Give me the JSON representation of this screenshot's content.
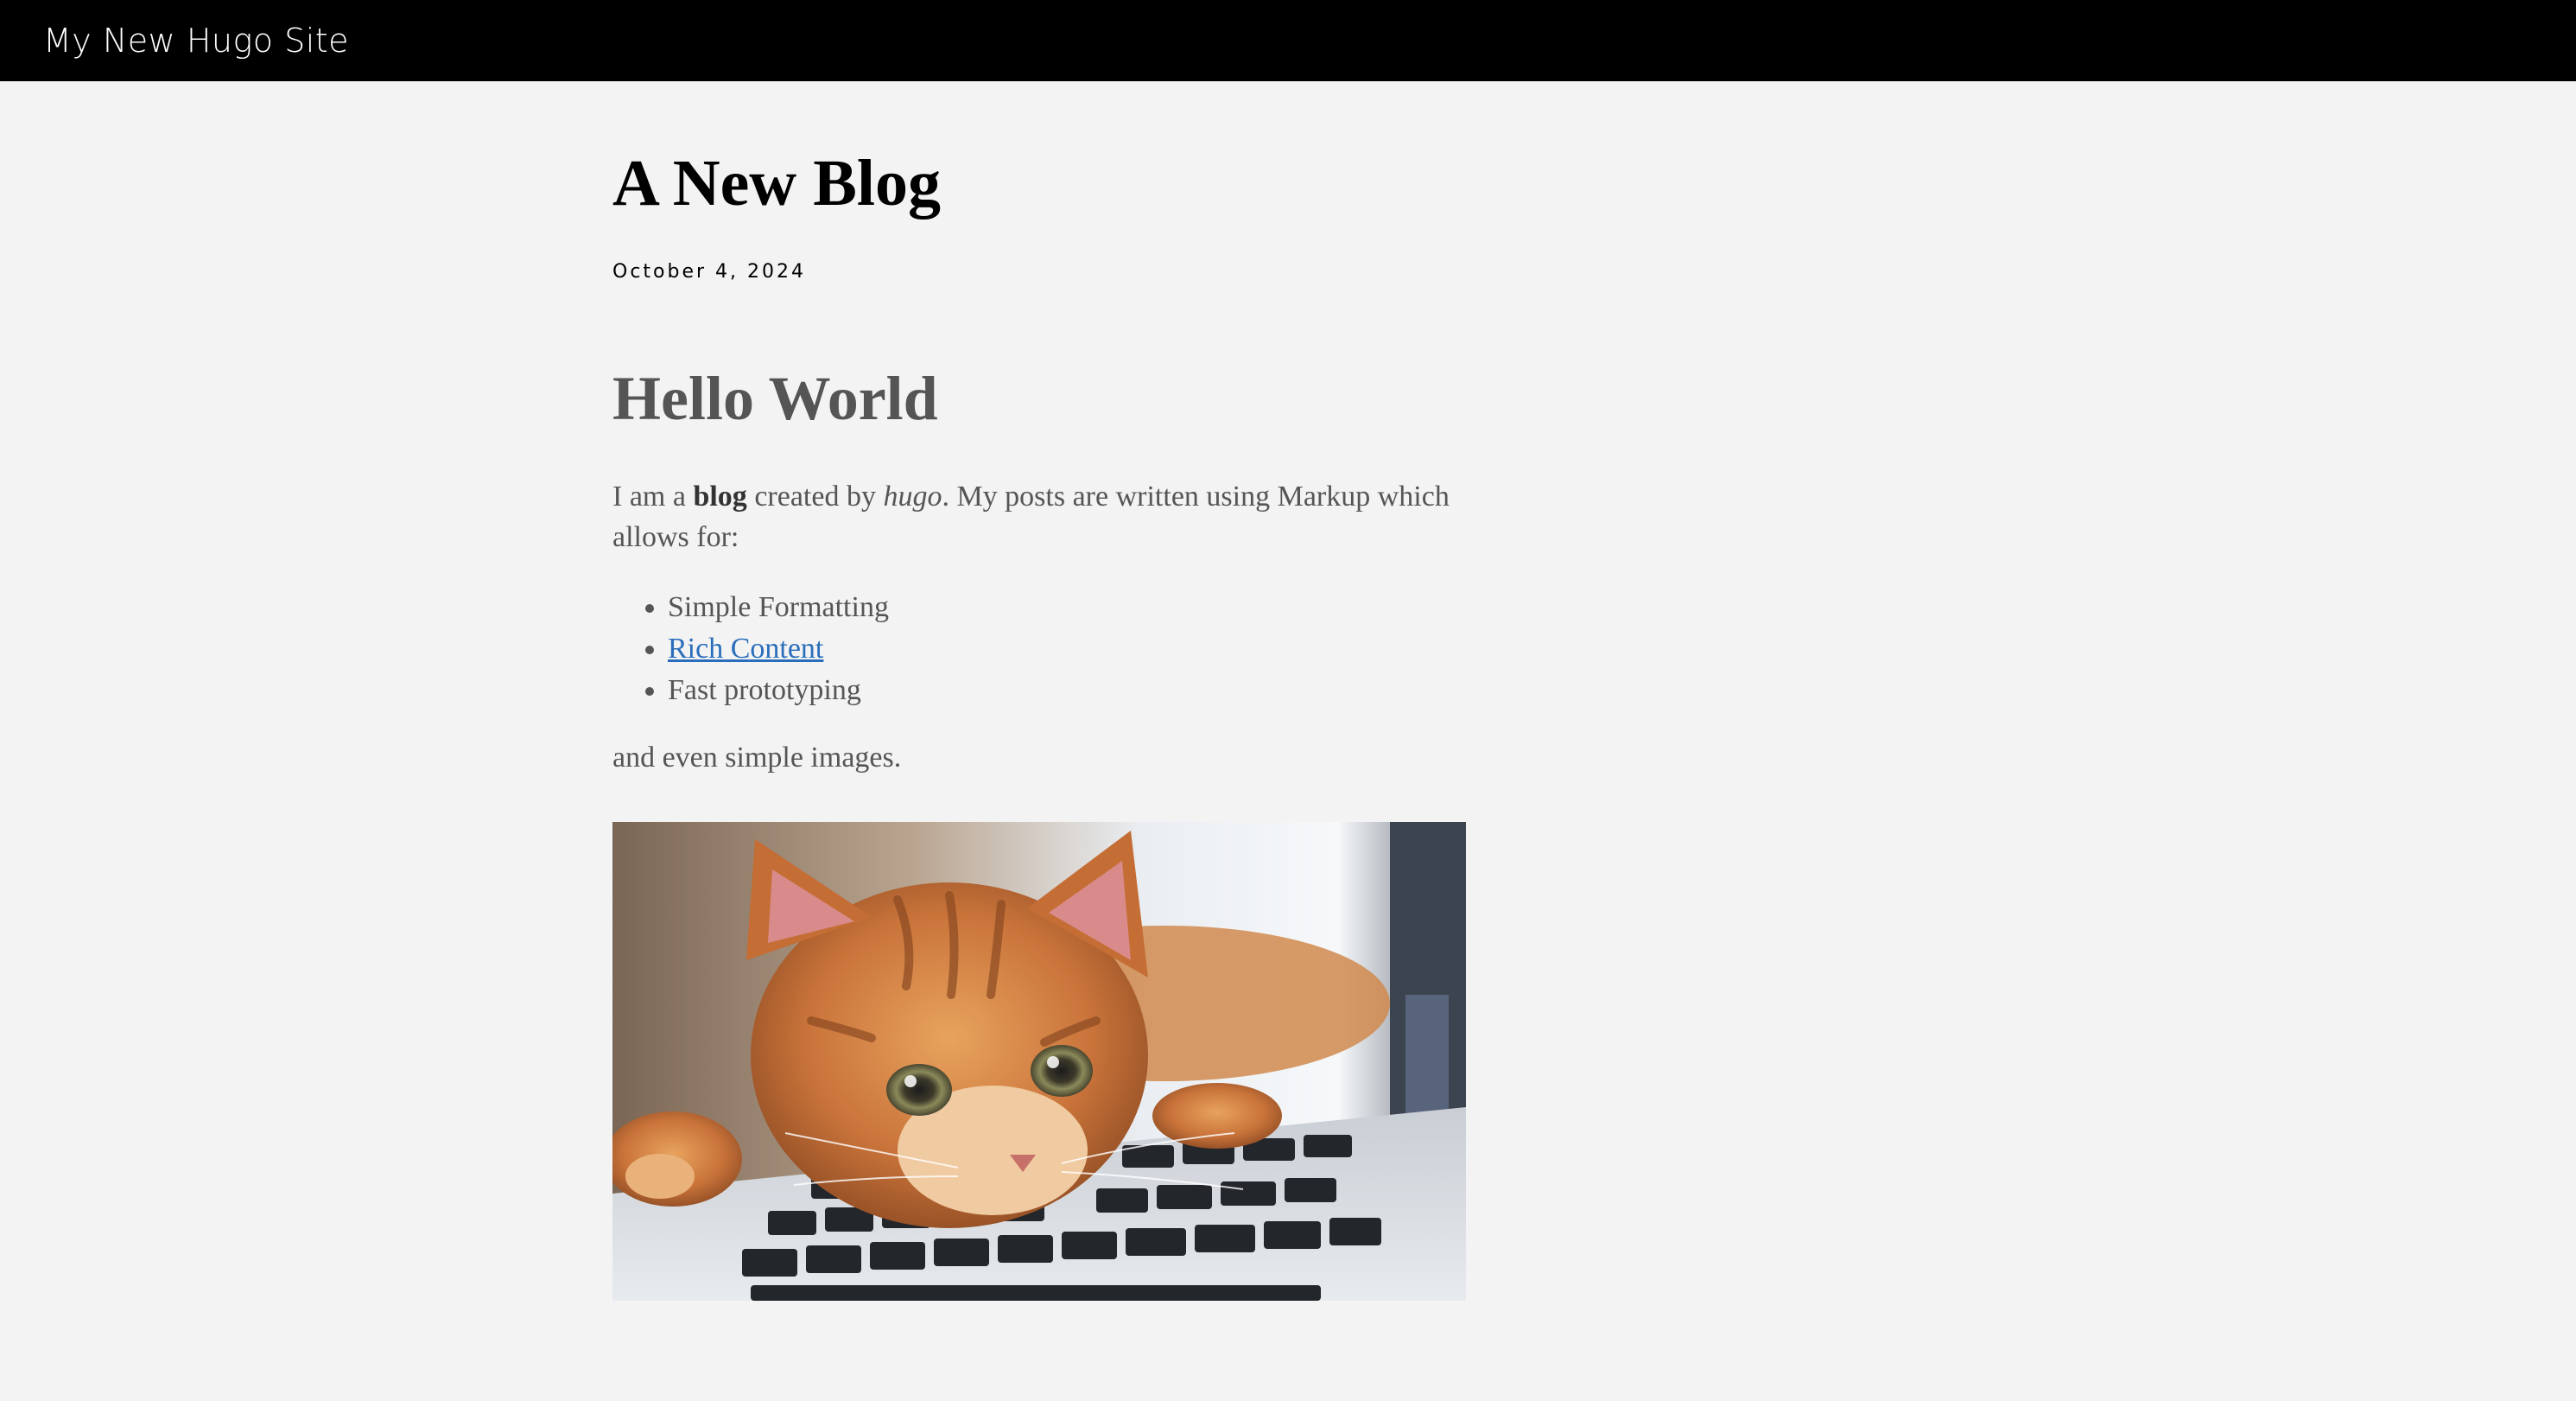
{
  "header": {
    "site_title": "My New Hugo Site"
  },
  "post": {
    "title": "A New Blog",
    "date": "October 4, 2024",
    "heading": "Hello World",
    "intro": {
      "part1": "I am a ",
      "bold": "blog",
      "part2": " created by ",
      "italic": "hugo",
      "part3": ". My posts are written using Markup which allows for:"
    },
    "list": [
      {
        "text": "Simple Formatting"
      },
      {
        "text": "Rich Content",
        "is_link": true
      },
      {
        "text": "Fast prototyping"
      }
    ],
    "outro": "and even simple images.",
    "image": {
      "subject": "orange tabby kitten lying on a laptop keyboard"
    }
  },
  "colors": {
    "header_bg": "#000000",
    "page_bg": "#f3f3f3",
    "body_text": "#555555",
    "link": "#2a6ebb"
  }
}
